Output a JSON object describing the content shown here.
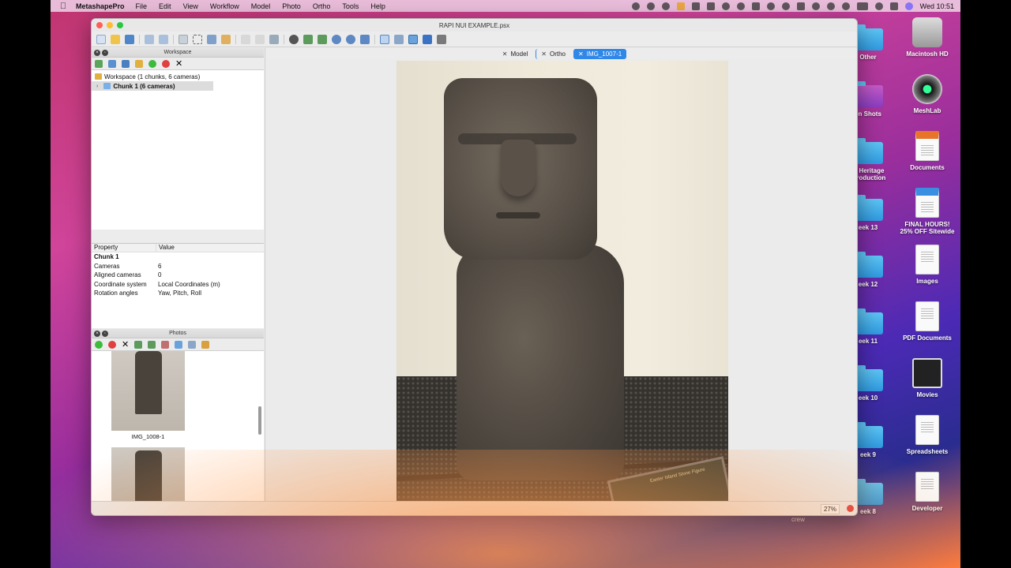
{
  "menubar": {
    "app_name": "MetashapePro",
    "items": [
      "File",
      "Edit",
      "View",
      "Workflow",
      "Model",
      "Photo",
      "Ortho",
      "Tools",
      "Help"
    ],
    "clock": "Wed 10:51"
  },
  "desktop": {
    "items": [
      {
        "label": "Other",
        "icon": "folder-icon"
      },
      {
        "label": "en Shots",
        "icon": "folder-icon"
      },
      {
        "label": "al Heritage",
        "label2": "ntroduction",
        "icon": "folder-icon"
      },
      {
        "label": "eek 13",
        "icon": "folder-icon"
      },
      {
        "label": "eek 12",
        "icon": "folder-icon"
      },
      {
        "label": "eek 11",
        "icon": "folder-icon"
      },
      {
        "label": "eek 10",
        "icon": "folder-icon"
      },
      {
        "label": "eek 9",
        "icon": "folder-icon"
      },
      {
        "label": "eek 8",
        "icon": "folder-icon"
      },
      {
        "label": "Macintosh HD",
        "icon": "hard-drive-icon"
      },
      {
        "label": "MeshLab",
        "icon": "meshlab-icon"
      },
      {
        "label": "Documents",
        "icon": "epub-document-icon"
      },
      {
        "label": "FINAL HOURS!",
        "label2": "25% OFF Sitewide",
        "icon": "eml-document-icon"
      },
      {
        "label": "Images",
        "icon": "tiff-document-icon"
      },
      {
        "label": "PDF Documents",
        "icon": "pdf-document-icon"
      },
      {
        "label": "Movies",
        "icon": "movies-icon"
      },
      {
        "label": "Spreadsheets",
        "icon": "spreadsheet-icon"
      },
      {
        "label": "Developer",
        "icon": "developer-document-icon"
      }
    ],
    "footer_text": "crew"
  },
  "window": {
    "title": "RAPI NUI EXAMPLE.psx",
    "workspace_panel": {
      "header": "Workspace",
      "tree": [
        {
          "label": "Workspace (1 chunks, 6 cameras)"
        },
        {
          "label": "Chunk 1 (6 cameras)",
          "selected": true
        }
      ]
    },
    "properties": {
      "col_property": "Property",
      "col_value": "Value",
      "title": "Chunk 1",
      "rows": [
        {
          "name": "Cameras",
          "value": "6"
        },
        {
          "name": "Aligned cameras",
          "value": "0"
        },
        {
          "name": "Coordinate system",
          "value": "Local Coordinates (m)"
        },
        {
          "name": "Rotation angles",
          "value": "Yaw, Pitch, Roll"
        }
      ]
    },
    "photos_panel": {
      "header": "Photos",
      "items": [
        {
          "label": "IMG_1008-1"
        }
      ]
    },
    "tabs": [
      {
        "label": "Model",
        "active": false
      },
      {
        "label": "Ortho",
        "active": false
      },
      {
        "label": "IMG_1007-1",
        "active": true
      }
    ],
    "photo": {
      "sign_text": "Easter Island Stone Figure"
    },
    "status": {
      "zoom": "27%"
    }
  },
  "colors": {
    "accent": "#2f87e8",
    "close": "#ff5f57",
    "minimize": "#febc2e",
    "maximize": "#28c840"
  }
}
